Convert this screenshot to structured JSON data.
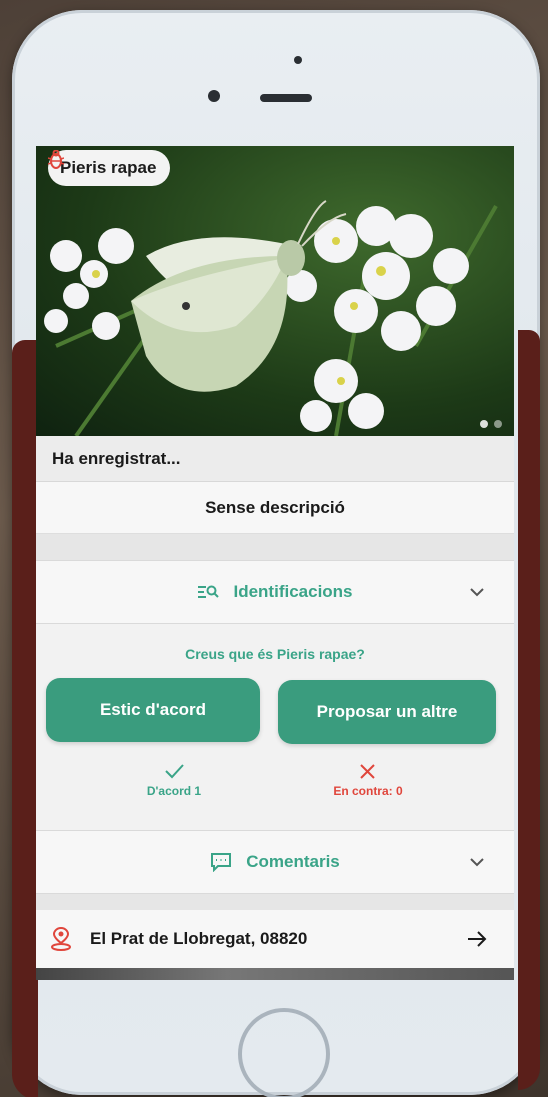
{
  "observation": {
    "species_name": "Pieris rapae",
    "recorded_label": "Ha enregistrat...",
    "description": "Sense descripció"
  },
  "identifications": {
    "header_label": "Identificacions",
    "question": "Creus que és Pieris rapae?",
    "agree_button": "Estic d'acord",
    "propose_button": "Proposar un altre",
    "agree_count_label": "D'acord 1",
    "against_count_label": "En contra: 0"
  },
  "comments": {
    "header_label": "Comentaris"
  },
  "location": {
    "label": "El Prat de Llobregat, 08820"
  },
  "gallery": {
    "current_index": 1,
    "total": 2
  },
  "icons": {
    "species": "bug-icon",
    "identifications": "identify-list-icon",
    "comments": "chat-bubble-icon",
    "location": "location-pin-icon",
    "go": "arrow-right-icon",
    "expand": "chevron-down-icon",
    "agree_mark": "check-icon",
    "against_mark": "x-icon"
  },
  "colors": {
    "accent": "#3aa488",
    "button": "#3a9c7e",
    "against": "#e0463c",
    "pin": "#e0463c"
  }
}
